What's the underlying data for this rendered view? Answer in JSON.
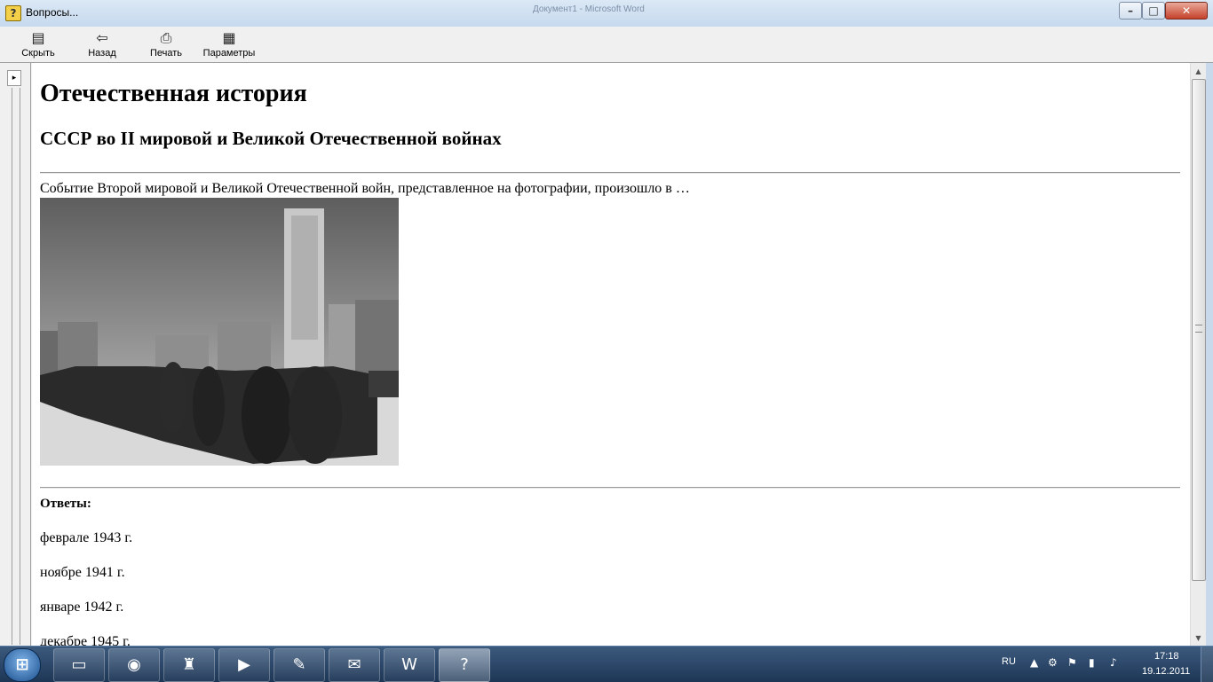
{
  "window": {
    "title": "Вопросы...",
    "ghost_title": "Документ1 - Microsoft Word",
    "min_glyph": "–",
    "max_glyph": "□",
    "close_glyph": "✕"
  },
  "toolbar": {
    "hide": {
      "label": "Скрыть",
      "icon": "hide-pane-icon",
      "glyph": "▤"
    },
    "back": {
      "label": "Назад",
      "icon": "back-arrow-icon",
      "glyph": "⇦"
    },
    "print": {
      "label": "Печать",
      "icon": "printer-icon",
      "glyph": "⎙"
    },
    "params": {
      "label": "Параметры",
      "icon": "options-icon",
      "glyph": "▦"
    }
  },
  "leftpane": {
    "expand_glyph": "▸"
  },
  "content": {
    "heading": "Отечественная история",
    "subheading": "СССР во II мировой и Великой Отечественной войнах",
    "question": "Событие Второй мировой и Великой Отечественной войн, представленное на фотографии, произошло в …",
    "photo": {
      "icon": "war-photo"
    },
    "answers_label": "Ответы:",
    "answers": [
      {
        "text": "феврале 1943 г."
      },
      {
        "text": "ноябре 1941 г."
      },
      {
        "text": "январе 1942 г."
      },
      {
        "text": "декабре 1945 г."
      }
    ]
  },
  "scrollbar": {
    "up_glyph": "▲",
    "down_glyph": "▼"
  },
  "taskbar": {
    "start_glyph": "⊞",
    "buttons": [
      {
        "name": "explorer",
        "glyph": "▭"
      },
      {
        "name": "firefox",
        "glyph": "◉"
      },
      {
        "name": "app-green",
        "glyph": "♜"
      },
      {
        "name": "media-player",
        "glyph": "▶"
      },
      {
        "name": "app-orange",
        "glyph": "✎"
      },
      {
        "name": "outlook",
        "glyph": "✉"
      },
      {
        "name": "word",
        "glyph": "W"
      },
      {
        "name": "help-questions",
        "glyph": "?"
      }
    ],
    "tray": {
      "language": "RU",
      "time": "17:18",
      "date": "19.12.2011"
    }
  }
}
